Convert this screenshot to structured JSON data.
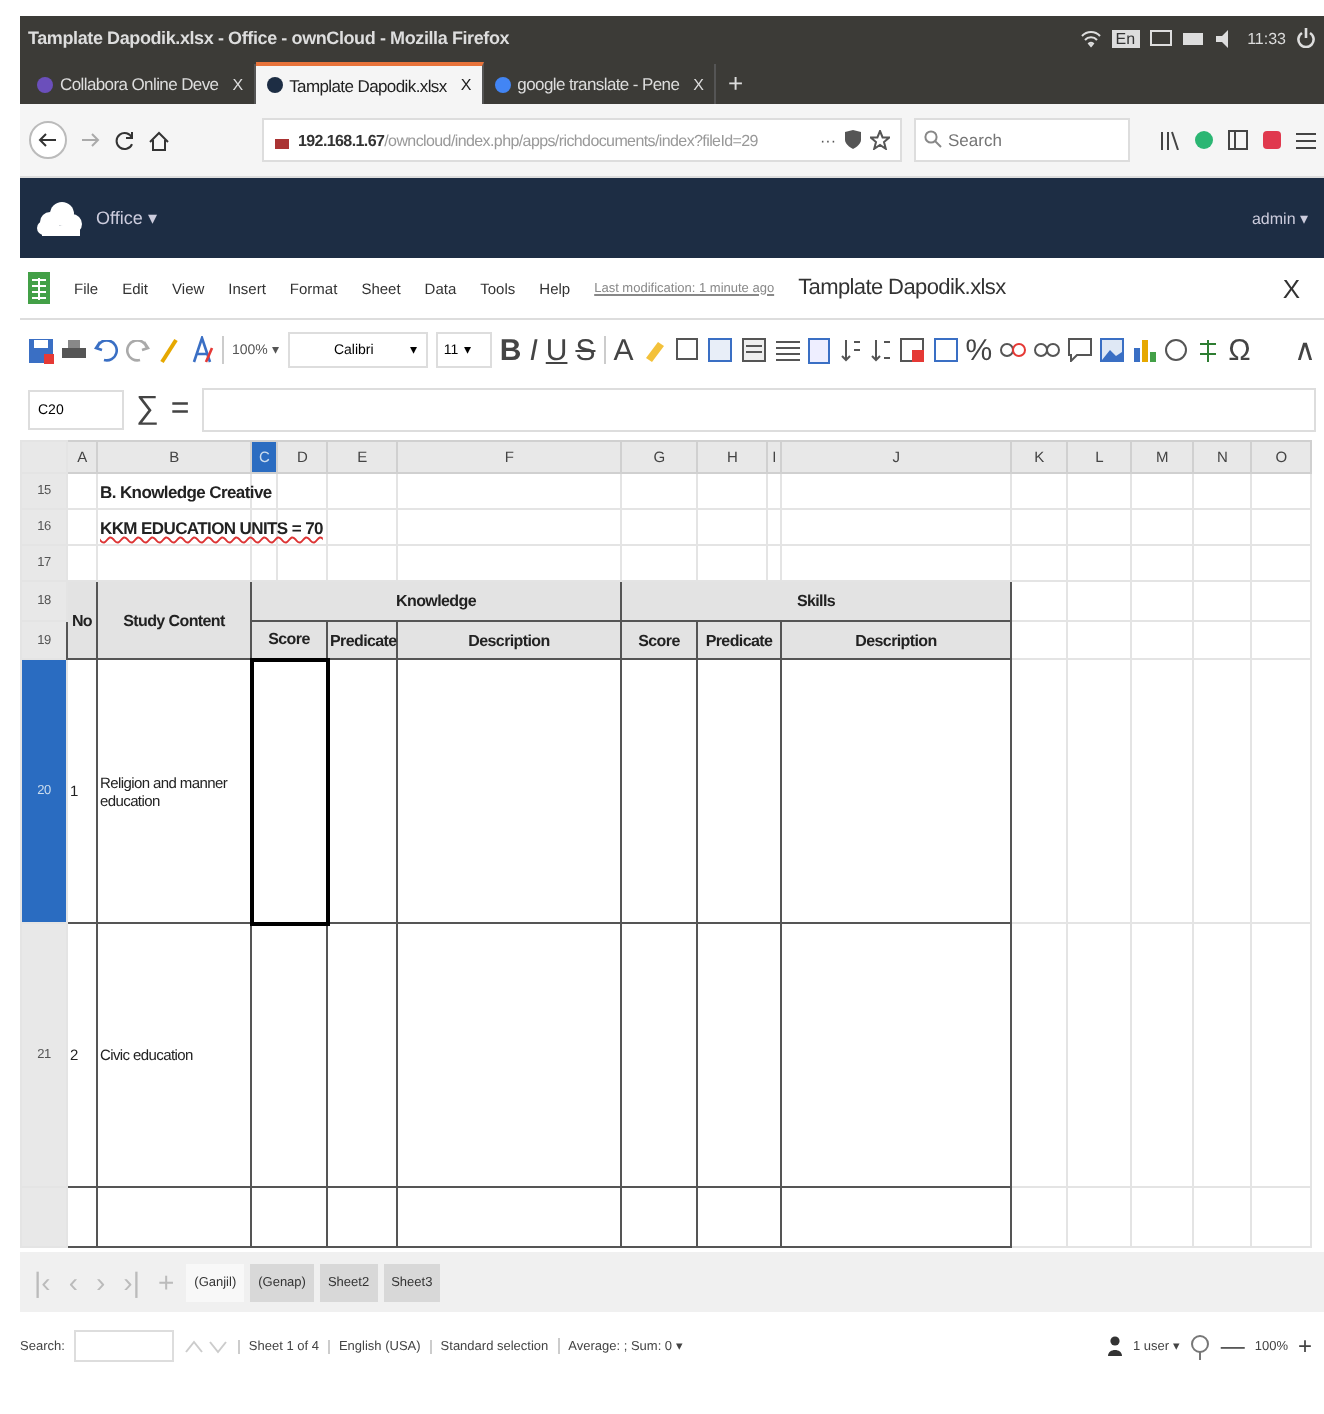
{
  "window": {
    "title": "Tamplate Dapodik.xlsx - Office - ownCloud - Mozilla Firefox",
    "keyboard": "En",
    "clock": "11:33"
  },
  "browser_tabs": [
    {
      "label": "Collabora Online Deve",
      "close": "X",
      "selected": false
    },
    {
      "label": "Tamplate Dapodik.xlsx",
      "close": "X",
      "selected": true
    },
    {
      "label": "google translate - Pene",
      "close": "X",
      "selected": false
    }
  ],
  "new_tab": "+",
  "address_bar": {
    "url_host": "192.168.1.67",
    "url_path": "/owncloud/index.php/apps/richdocuments/index?fileId=29",
    "more": "···"
  },
  "search": {
    "placeholder": "Search"
  },
  "app_header": {
    "app": "Office ▾",
    "user": "admin ▾"
  },
  "menu": [
    "File",
    "Edit",
    "View",
    "Insert",
    "Format",
    "Sheet",
    "Data",
    "Tools",
    "Help"
  ],
  "last_modification": "Last modification: 1 minute ago",
  "document_title": "Tamplate Dapodik.xlsx",
  "close": "X",
  "toolbar": {
    "zoom": "100%",
    "zoom_caret": "▾",
    "font": "Calibri",
    "size": "11",
    "caret": "▾",
    "format_glyphs": [
      "B",
      "I",
      "U",
      "S"
    ],
    "font_glyph": "A",
    "percent": "%",
    "omega": "Ω",
    "collapse": "∧"
  },
  "formula_bar": {
    "cell_ref": "C20",
    "sigma": "∑",
    "equals": "="
  },
  "sheet": {
    "columns": [
      {
        "letter": "A",
        "selected": false
      },
      {
        "letter": "B",
        "selected": false
      },
      {
        "letter": "C",
        "selected": true
      },
      {
        "letter": "D",
        "selected": false
      },
      {
        "letter": "E",
        "selected": false
      },
      {
        "letter": "F",
        "selected": false
      },
      {
        "letter": "G",
        "selected": false
      },
      {
        "letter": "H",
        "selected": false
      },
      {
        "letter": "I",
        "selected": false
      },
      {
        "letter": "J",
        "selected": false
      },
      {
        "letter": "K",
        "selected": false
      },
      {
        "letter": "L",
        "selected": false
      },
      {
        "letter": "M",
        "selected": false
      },
      {
        "letter": "N",
        "selected": false
      },
      {
        "letter": "O",
        "selected": false
      }
    ],
    "row_numbers": [
      {
        "number": "15",
        "selected": false
      },
      {
        "number": "16",
        "selected": false
      },
      {
        "number": "17",
        "selected": false
      },
      {
        "number": "18",
        "selected": false
      },
      {
        "number": "19",
        "selected": false
      },
      {
        "number": "20",
        "selected": true
      },
      {
        "number": "21",
        "selected": false
      }
    ],
    "notes": [
      "B. Knowledge Creative",
      "KKM EDUCATION UNITS = 70"
    ],
    "headers": {
      "no": "No",
      "study_content": "Study Content",
      "knowledge": "Knowledge",
      "skills": "Skills",
      "sub": [
        "Score",
        "Predicate",
        "Description",
        "Score",
        "Predicate",
        "Description"
      ]
    },
    "rows": [
      {
        "no": "1",
        "study_content": "Religion and manner education"
      },
      {
        "no": "2",
        "study_content": "Civic education"
      }
    ]
  },
  "sheet_nav": [
    "|‹",
    "‹",
    "›",
    "›|",
    "+"
  ],
  "sheet_tabs": [
    {
      "label": "(Ganjil)",
      "selected": true
    },
    {
      "label": "(Genap)",
      "selected": false
    },
    {
      "label": "Sheet2",
      "selected": false
    },
    {
      "label": "Sheet3",
      "selected": false
    }
  ],
  "status_bar": {
    "search_label": "Search:",
    "sheet": "Sheet 1 of 4",
    "language": "English (USA)",
    "selection": "Standard selection",
    "summary": "Average: ; Sum: 0",
    "summary_caret": "▾",
    "users": "1 user ▾",
    "minus": "—",
    "zoom": "100%",
    "plus": "+"
  }
}
